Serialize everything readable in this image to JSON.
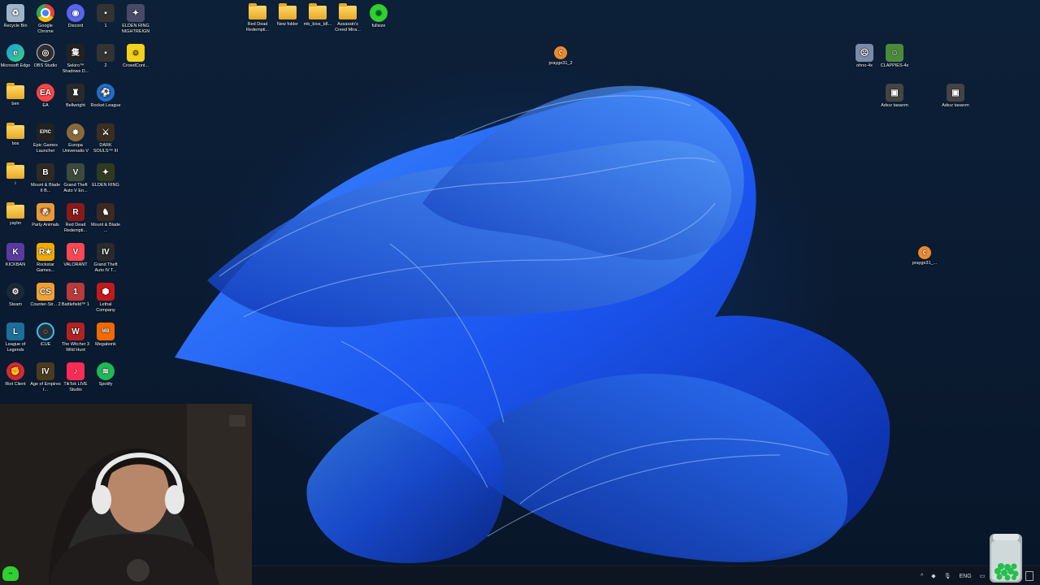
{
  "desktop_icons": [
    {
      "label": "Recycle Bin",
      "icon": "recycle-bin-icon",
      "color": "#9fb6c9"
    },
    {
      "label": "Google Chrome",
      "icon": "chrome-icon",
      "color": "#e94235"
    },
    {
      "label": "Discord",
      "icon": "discord-icon",
      "color": "#5865f2"
    },
    {
      "label": "1",
      "icon": "shortcut-icon",
      "color": "#333333"
    },
    {
      "label": "ELDEN RING NIGHTREIGN",
      "icon": "elden-ring-nightreign-icon",
      "color": "#4a4a66"
    },
    {
      "label": "Microsoft Edge",
      "icon": "edge-icon",
      "color": "#1a9be0"
    },
    {
      "label": "OBS Studio",
      "icon": "obs-icon",
      "color": "#302e31"
    },
    {
      "label": "Sekiro™ Shadows D...",
      "icon": "sekiro-icon",
      "color": "#222222"
    },
    {
      "label": "2",
      "icon": "shortcut-icon",
      "color": "#333333"
    },
    {
      "label": "CrowdCont...",
      "icon": "crowdcontrol-icon",
      "color": "#f2d21b"
    },
    {
      "label": "ben",
      "icon": "folder-icon",
      "color": "#f5c242"
    },
    {
      "label": "EA",
      "icon": "ea-icon",
      "color": "#ff4747"
    },
    {
      "label": "Bellwright",
      "icon": "bellwright-icon",
      "color": "#2a2a2a"
    },
    {
      "label": "Rocket League",
      "icon": "rocket-league-icon",
      "color": "#1f6fd1"
    },
    {
      "label": "bos",
      "icon": "folder-icon",
      "color": "#f5c242"
    },
    {
      "label": "Epic Games Launcher",
      "icon": "epic-games-icon",
      "color": "#222222"
    },
    {
      "label": "Europa Universalis V",
      "icon": "europa-universalis-icon",
      "color": "#8a6a3a"
    },
    {
      "label": "DARK SOULS™ III",
      "icon": "dark-souls-icon",
      "color": "#3a2e20"
    },
    {
      "label": "i",
      "icon": "folder-icon",
      "color": "#f5c242"
    },
    {
      "label": "Mount & Blade II B...",
      "icon": "mount-blade-icon",
      "color": "#2f2a24"
    },
    {
      "label": "Grand Theft Auto V En...",
      "icon": "gta-v-icon",
      "color": "#3b4b3b"
    },
    {
      "label": "ELDEN RING",
      "icon": "elden-ring-icon",
      "color": "#2f3a20"
    },
    {
      "label": "yaylın",
      "icon": "folder-icon",
      "color": "#f5c242"
    },
    {
      "label": "Party Animals",
      "icon": "party-animals-icon",
      "color": "#e99a3a"
    },
    {
      "label": "Red Dead Redempti...",
      "icon": "red-dead-icon",
      "color": "#8a1a1a"
    },
    {
      "label": "Mount & Blade ...",
      "icon": "mount-blade-icon",
      "color": "#3a2a22"
    },
    {
      "label": "KICKBAN",
      "icon": "kickban-icon",
      "color": "#5b3aa0"
    },
    {
      "label": "Rockstar Games...",
      "icon": "rockstar-icon",
      "color": "#f2a900"
    },
    {
      "label": "VALORANT",
      "icon": "valorant-icon",
      "color": "#ff4655"
    },
    {
      "label": "Grand Theft Auto IV T...",
      "icon": "gta-iv-icon",
      "color": "#2a2a2a"
    },
    {
      "label": "Steam",
      "icon": "steam-icon",
      "color": "#1b2838"
    },
    {
      "label": "Counter-Str... 2",
      "icon": "counter-strike-icon",
      "color": "#f0a030"
    },
    {
      "label": "Battlefield™ 1",
      "icon": "battlefield-icon",
      "color": "#b83a3a"
    },
    {
      "label": "Lethal Company",
      "icon": "lethal-company-icon",
      "color": "#c21a1a"
    },
    {
      "label": "League of Legends",
      "icon": "league-icon",
      "color": "#1d6f9a"
    },
    {
      "label": "iCUE",
      "icon": "icue-icon",
      "color": "#2a2f35"
    },
    {
      "label": "The Witcher 3 Wild Hunt",
      "icon": "witcher-icon",
      "color": "#b22222"
    },
    {
      "label": "Megabonk",
      "icon": "megabonk-icon",
      "color": "#f06a00"
    },
    {
      "label": "Riot Client",
      "icon": "riot-icon",
      "color": "#d32936"
    },
    {
      "label": "Age of Empires I...",
      "icon": "age-of-empires-icon",
      "color": "#4a3a20"
    },
    {
      "label": "TikTok LIVE Studio",
      "icon": "tiktok-icon",
      "color": "#fe2c55"
    },
    {
      "label": "Spotify",
      "icon": "spotify-icon",
      "color": "#1db954"
    }
  ],
  "top_icons": [
    {
      "label": "Red Dead Redempti...",
      "icon": "folder-icon"
    },
    {
      "label": "New folder",
      "icon": "folder-icon"
    },
    {
      "label": "mb_bios_b8...",
      "icon": "folder-icon"
    },
    {
      "label": "Assassin's Creed Mira...",
      "icon": "folder-icon"
    },
    {
      "label": "fullsize",
      "icon": "frog-icon"
    }
  ],
  "right_icons": [
    {
      "label": "praygе31_2",
      "icon": "hamster-icon",
      "color": "#f08a2a"
    },
    {
      "label": "ohno-4x",
      "icon": "pepe-icon",
      "color": "#7a8aa8"
    },
    {
      "label": "CLAPPIES-4x",
      "icon": "pepe-icon",
      "color": "#4a8a3a"
    },
    {
      "label": "Adsız tasarım",
      "icon": "image-icon",
      "color": "#444444"
    },
    {
      "label": "Adsız tasarım",
      "icon": "image-icon",
      "color": "#444444"
    },
    {
      "label": "praygе31_...",
      "icon": "hamster-icon",
      "color": "#f08a2a"
    }
  ],
  "taskbar": {
    "tray_chevron": "^",
    "language": "ENG"
  },
  "colors": {
    "wallpaper_accent": "#1e6bff",
    "wallpaper_deep": "#0a2a8a",
    "taskbar": "#0e1622"
  }
}
